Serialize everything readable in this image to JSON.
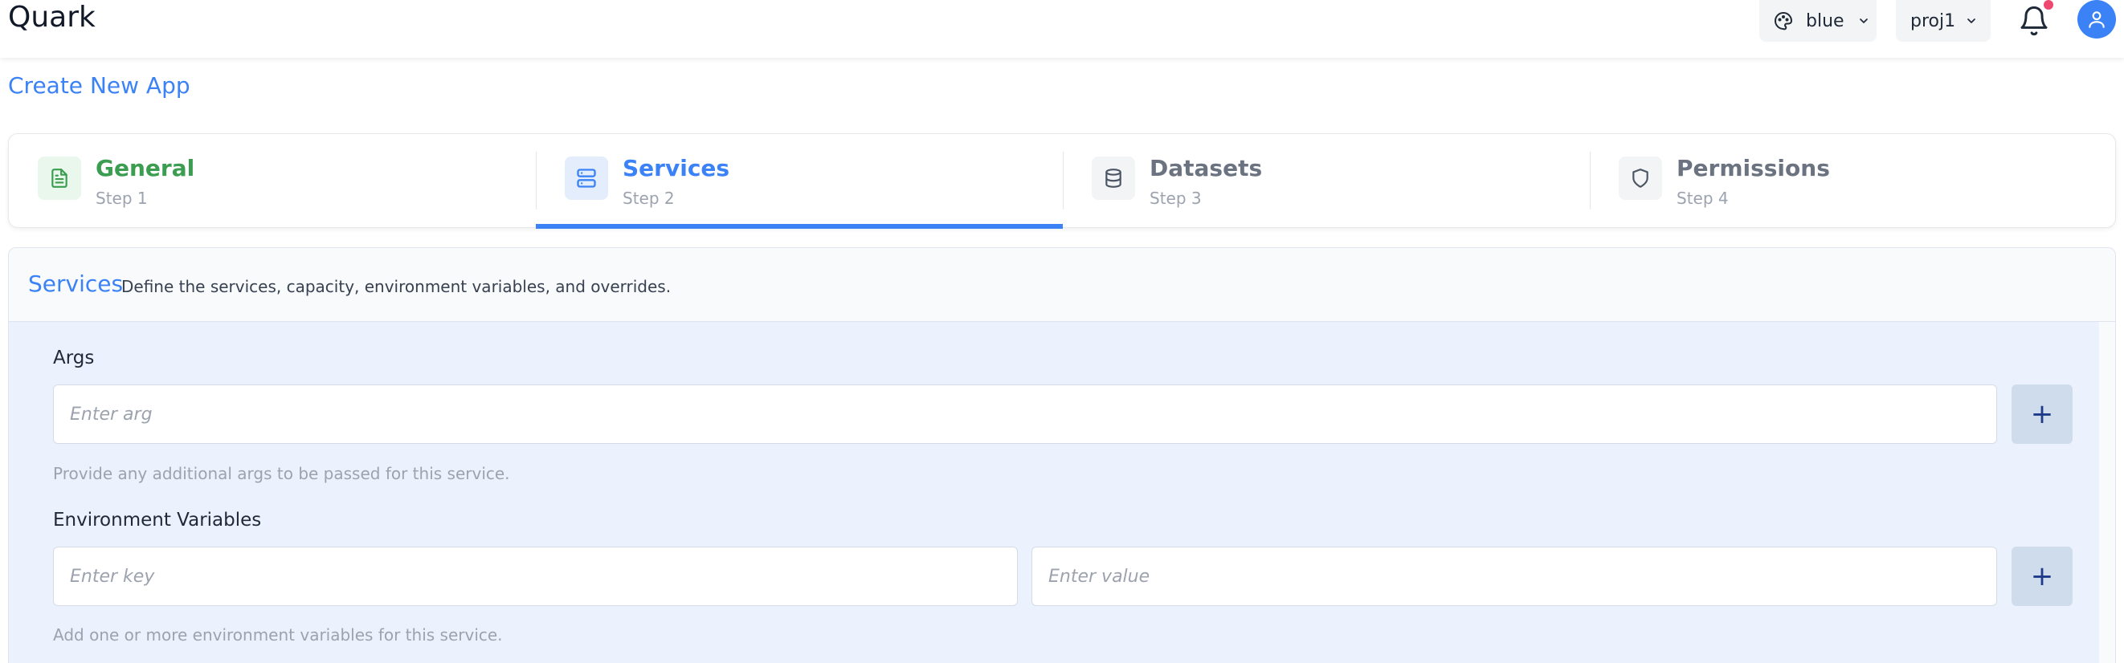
{
  "app": {
    "title": "Quark"
  },
  "header": {
    "theme_label": "blue",
    "project_label": "proj1",
    "theme_icon": "palette-icon",
    "notification_icon": "bell-icon",
    "avatar_icon": "user-icon"
  },
  "page": {
    "heading": "Create New App"
  },
  "stepper": {
    "steps": [
      {
        "title": "General",
        "subtitle": "Step 1",
        "state": "completed",
        "icon": "document-icon"
      },
      {
        "title": "Services",
        "subtitle": "Step 2",
        "state": "active",
        "icon": "server-icon"
      },
      {
        "title": "Datasets",
        "subtitle": "Step 3",
        "state": "pending",
        "icon": "database-icon"
      },
      {
        "title": "Permissions",
        "subtitle": "Step 4",
        "state": "pending",
        "icon": "shield-icon"
      }
    ]
  },
  "section": {
    "title": "Services",
    "description": "Define the services, capacity, environment variables, and overrides.",
    "args": {
      "label": "Args",
      "placeholder": "Enter arg",
      "value": "",
      "add_label": "+",
      "help": "Provide any additional args to be passed for this service."
    },
    "env": {
      "label": "Environment Variables",
      "key_placeholder": "Enter key",
      "value_placeholder": "Enter value",
      "add_label": "+",
      "help": "Add one or more environment variables for this service."
    }
  },
  "colors": {
    "accent": "#3b82f6",
    "success": "#3a9d4f",
    "notification_dot": "#ef476f",
    "section_body_bg": "#ebf2fd"
  }
}
